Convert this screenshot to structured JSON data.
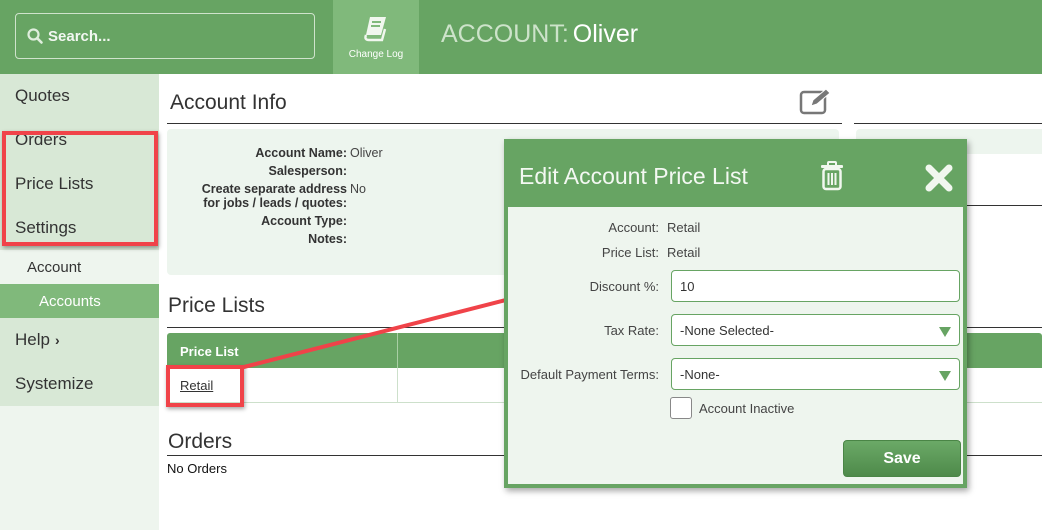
{
  "colors": {
    "brand_green": "#67a463",
    "light_green": "#80b97b",
    "panel_bg": "#edf5ee",
    "highlight_red": "#f04349"
  },
  "header": {
    "search_placeholder": "Search...",
    "search_icon": "search-icon",
    "changelog_label": "Change Log",
    "changelog_icon": "book-icon",
    "title_prefix": "ACCOUNT:",
    "title_name": "Oliver"
  },
  "sidebar": {
    "items": [
      {
        "label": "Quotes"
      },
      {
        "label": "Orders"
      },
      {
        "label": "Price Lists"
      },
      {
        "label": "Settings"
      },
      {
        "label": "Account"
      },
      {
        "label": "Accounts",
        "active": true
      },
      {
        "label": "Help",
        "icon": "chevron-right-icon"
      },
      {
        "label": "Systemize"
      }
    ]
  },
  "account_info": {
    "title": "Account Info",
    "edit_icon": "edit-icon",
    "fields": [
      {
        "label": "Account Name:",
        "value": "Oliver"
      },
      {
        "label": "Salesperson:",
        "value": ""
      },
      {
        "label": "Create separate address for jobs / leads / quotes:",
        "label_line1": "Create separate address",
        "label_line2": "for jobs / leads / quotes:",
        "value": "No"
      },
      {
        "label": "Account Type:",
        "value": ""
      },
      {
        "label": "Notes:",
        "value": ""
      }
    ]
  },
  "price_lists": {
    "title": "Price Lists",
    "columns": [
      "Price List",
      ""
    ],
    "rows": [
      {
        "price_list": "Retail"
      }
    ]
  },
  "orders": {
    "title": "Orders",
    "empty_text": "No Orders"
  },
  "modal": {
    "title": "Edit Account Price List",
    "delete_icon": "trash-icon",
    "close_icon": "close-icon",
    "account_label": "Account:",
    "account_value": "Retail",
    "price_list_label": "Price List:",
    "price_list_value": "Retail",
    "discount_label": "Discount %:",
    "discount_value": "10",
    "tax_rate_label": "Tax Rate:",
    "tax_rate_value": "-None Selected-",
    "payment_terms_label": "Default Payment Terms:",
    "payment_terms_value": "-None-",
    "inactive_label": "Account Inactive",
    "inactive_checked": false,
    "save_label": "Save"
  }
}
